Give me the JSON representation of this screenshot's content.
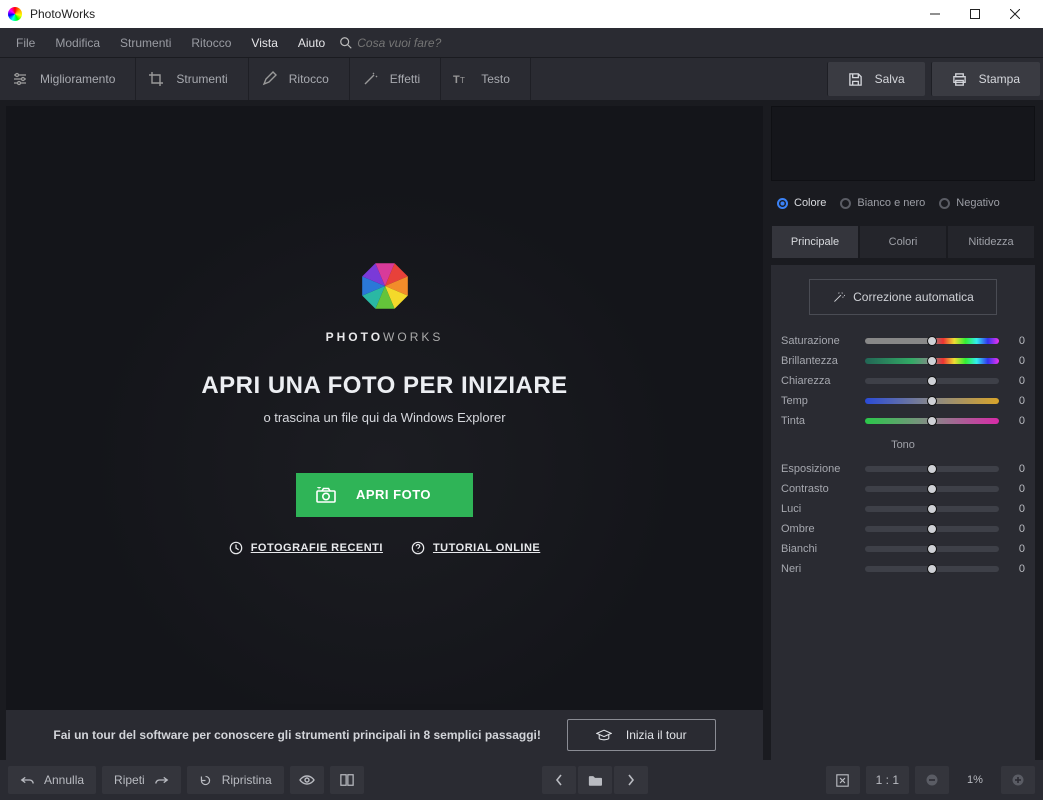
{
  "window": {
    "title": "PhotoWorks"
  },
  "menu": {
    "items": [
      "File",
      "Modifica",
      "Strumenti",
      "Ritocco",
      "Vista",
      "Aiuto"
    ],
    "active": [
      false,
      false,
      false,
      false,
      true,
      true
    ],
    "search_placeholder": "Cosa vuoi fare?"
  },
  "toolbar": {
    "enhance": "Miglioramento",
    "tools": "Strumenti",
    "retouch": "Ritocco",
    "effects": "Effetti",
    "text": "Testo",
    "save": "Salva",
    "print": "Stampa"
  },
  "canvas": {
    "brand1": "PHOTO",
    "brand2": "WORKS",
    "headline": "APRI UNA FOTO PER INIZIARE",
    "subline": "o trascina un file qui da Windows Explorer",
    "open": "APRI FOTO",
    "recent": "FOTOGRAFIE RECENTI",
    "tutorial": "TUTORIAL ONLINE"
  },
  "tour": {
    "text": "Fai un tour del software per conoscere gli strumenti principali in 8 semplici passaggi!",
    "button": "Inizia il tour"
  },
  "side": {
    "radios": {
      "color": "Colore",
      "bw": "Bianco e nero",
      "neg": "Negativo"
    },
    "tabs": {
      "main": "Principale",
      "colors": "Colori",
      "sharp": "Nitidezza"
    },
    "auto": "Correzione automatica",
    "tone_label": "Tono",
    "sliders": {
      "sat": {
        "label": "Saturazione",
        "value": "0"
      },
      "brl": {
        "label": "Brillantezza",
        "value": "0"
      },
      "clr": {
        "label": "Chiarezza",
        "value": "0"
      },
      "tmp": {
        "label": "Temp",
        "value": "0"
      },
      "tnt": {
        "label": "Tinta",
        "value": "0"
      },
      "exp": {
        "label": "Esposizione",
        "value": "0"
      },
      "con": {
        "label": "Contrasto",
        "value": "0"
      },
      "hi": {
        "label": "Luci",
        "value": "0"
      },
      "sh": {
        "label": "Ombre",
        "value": "0"
      },
      "wh": {
        "label": "Bianchi",
        "value": "0"
      },
      "bl": {
        "label": "Neri",
        "value": "0"
      }
    }
  },
  "status": {
    "undo": "Annulla",
    "redo": "Ripeti",
    "reset": "Ripristina",
    "ratio": "1 : 1",
    "zoom": "1%"
  }
}
